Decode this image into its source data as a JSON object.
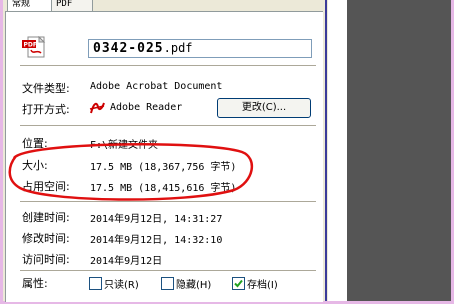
{
  "tabs": [
    "常规",
    "PDF"
  ],
  "file": {
    "name_main": "0342-025",
    "name_ext": ".pdf"
  },
  "rows": {
    "type_label": "文件类型:",
    "type_value": "Adobe Acrobat Document",
    "open_label": "打开方式:",
    "open_value": "Adobe Reader",
    "change_button": "更改(C)...",
    "location_label": "位置:",
    "location_value": "F:\\新建文件夹",
    "size_label": "大小:",
    "size_value": "17.5 MB (18,367,756 字节)",
    "disk_label": "占用空间:",
    "disk_value": "17.5 MB (18,415,616 字节)",
    "created_label": "创建时间:",
    "created_value": "2014年9月12日, 14:31:27",
    "modified_label": "修改时间:",
    "modified_value": "2014年9月12日, 14:32:10",
    "accessed_label": "访问时间:",
    "accessed_value": "2014年9月12日"
  },
  "attributes": {
    "label": "属性:",
    "readonly": "只读(R)",
    "hidden": "隐藏(H)",
    "archive": "存档(I)",
    "readonly_checked": false,
    "hidden_checked": false,
    "archive_checked": true
  },
  "colors": {
    "highlight_ellipse": "#e01010",
    "pdf_red": "#cc0000"
  }
}
